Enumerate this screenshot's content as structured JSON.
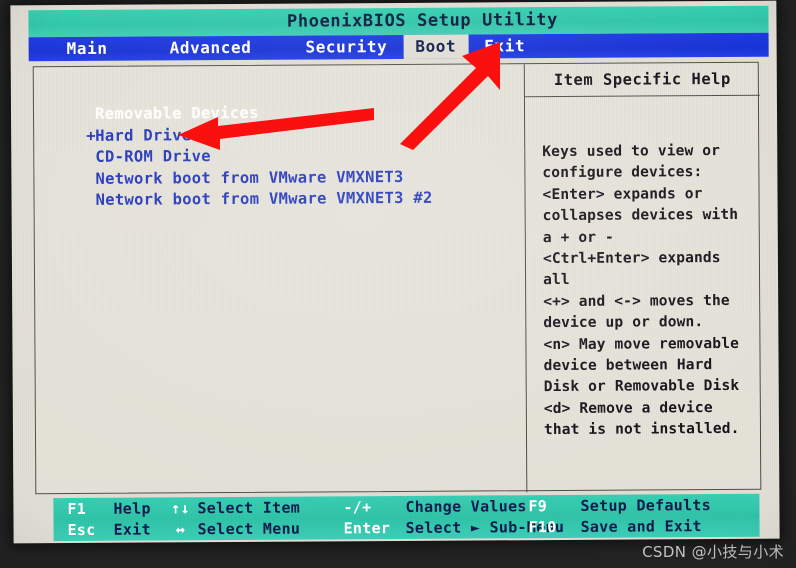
{
  "titlebar": {
    "title": "PhoenixBIOS Setup Utility"
  },
  "menubar": {
    "items": [
      {
        "label": "Main",
        "active": false
      },
      {
        "label": "Advanced",
        "active": false
      },
      {
        "label": "Security",
        "active": false
      },
      {
        "label": "Boot",
        "active": true
      },
      {
        "label": "Exit",
        "active": false
      }
    ]
  },
  "boot_list": {
    "items": [
      {
        "prefix": " ",
        "label": "Removable Devices",
        "selected": true
      },
      {
        "prefix": "+",
        "label": "Hard Drive",
        "selected": false
      },
      {
        "prefix": " ",
        "label": "CD-ROM Drive",
        "selected": false
      },
      {
        "prefix": " ",
        "label": "Network boot from VMware VMXNET3",
        "selected": false
      },
      {
        "prefix": " ",
        "label": "Network boot from VMware VMXNET3 #2",
        "selected": false
      }
    ]
  },
  "help": {
    "title": "Item Specific Help",
    "lines": [
      "Keys used to view or",
      "configure devices:",
      "<Enter> expands or",
      "collapses devices with",
      "a + or -",
      "<Ctrl+Enter> expands",
      "all",
      "<+> and <-> moves the",
      "device up or down.",
      "<n> May move removable",
      "device between Hard",
      "Disk or Removable Disk",
      "<d> Remove a device",
      "that is not installed."
    ]
  },
  "footer": {
    "keys": [
      {
        "key": "F1",
        "desc": "Help"
      },
      {
        "key": "Esc",
        "desc": "Exit"
      }
    ],
    "arrows": [
      {
        "key": "↑↓",
        "desc": "Select Item"
      },
      {
        "key": "↔",
        "desc": "Select Menu"
      }
    ],
    "values": [
      {
        "key": "-/+",
        "desc": "Change Values"
      },
      {
        "key": "Enter",
        "desc": "Select ► Sub-Menu"
      }
    ],
    "fn": [
      {
        "key": "F9",
        "desc": "Setup Defaults"
      },
      {
        "key": "F10",
        "desc": "Save and Exit"
      }
    ]
  },
  "annotations": {
    "color": "#fb1010",
    "arrow_boot_target": "Boot",
    "arrow_drive_target": "Hard Drive"
  },
  "watermark": {
    "text": "CSDN @小技与小术"
  },
  "colors": {
    "titlebar_teal": "#2ec3a5",
    "menubar_blue": "#1730d2",
    "screen_bg": "#dedbd2",
    "text_blue": "#2033b8",
    "accent_red": "#fb1010"
  }
}
